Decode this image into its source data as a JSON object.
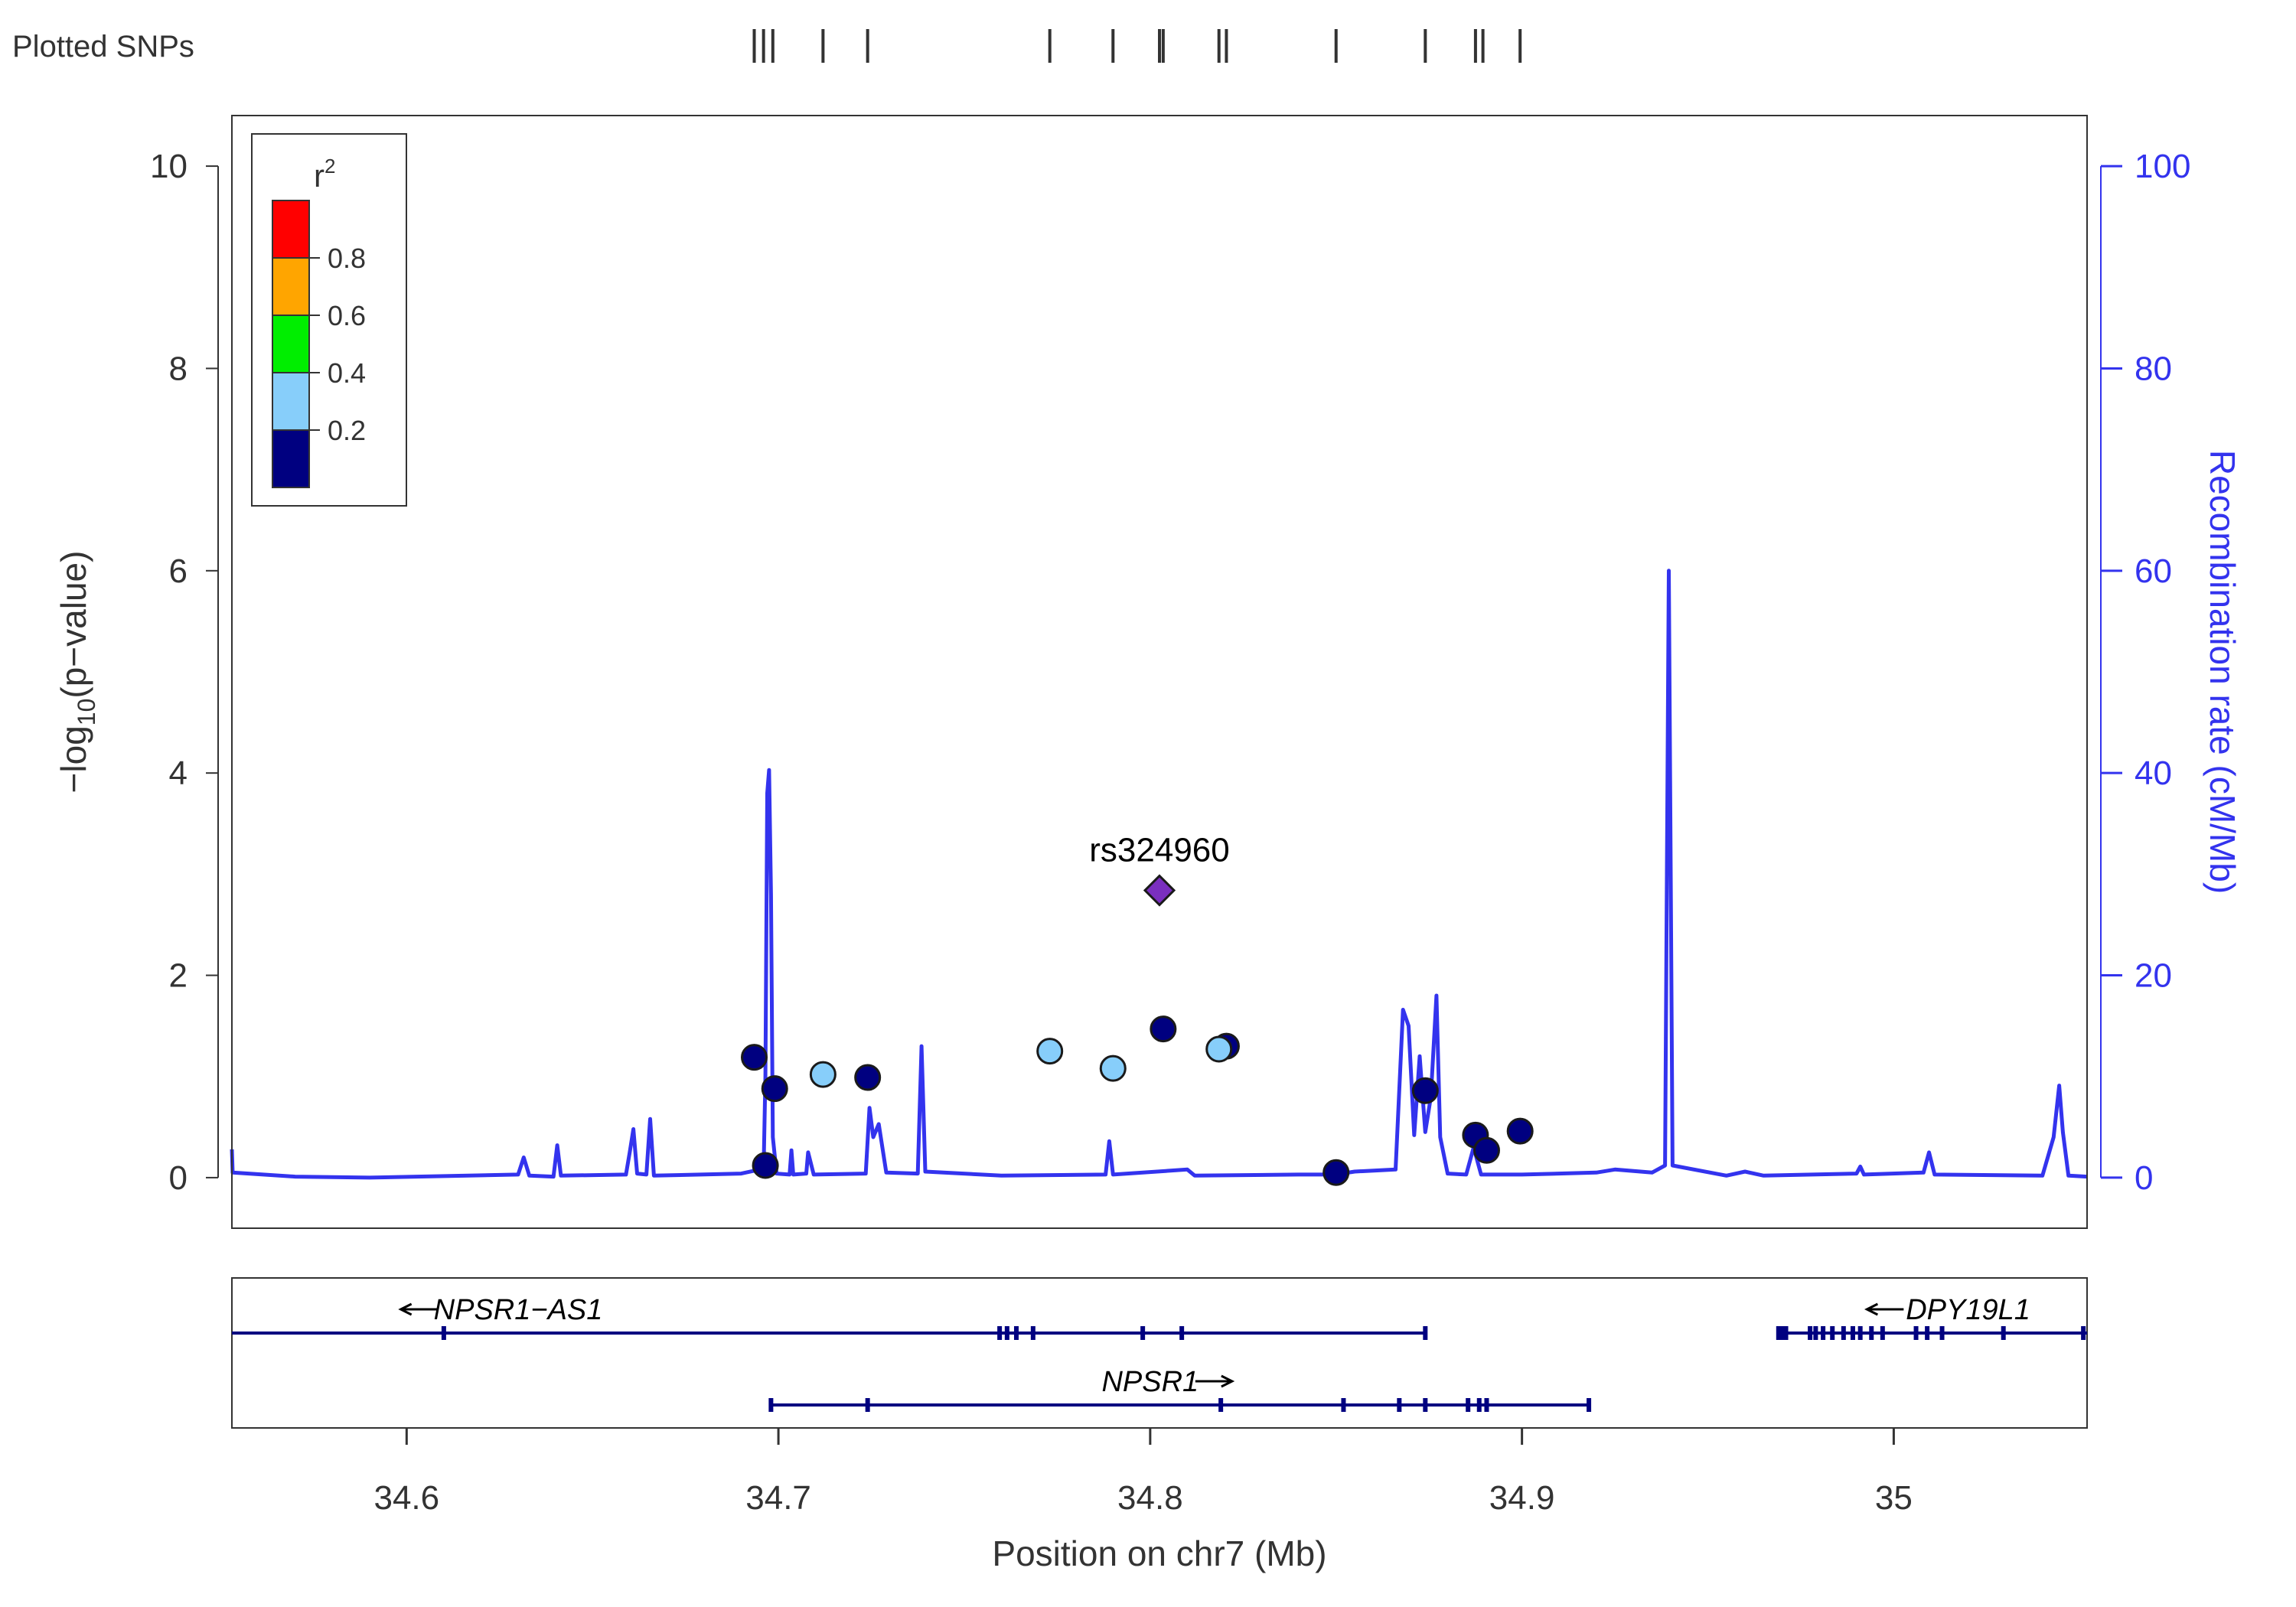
{
  "chart_data": {
    "type": "scatter",
    "xlabel": "Position on chr7 (Mb)",
    "ylabel_left": {
      "pre": "−log",
      "sub": "10",
      "post": "(p−value)"
    },
    "ylabel_right": "Recombination rate (cM/Mb)",
    "xlim": [
      34.553,
      35.052
    ],
    "ylim": [
      -0.5,
      10.5
    ],
    "y2lim": [
      -5,
      105
    ],
    "x_ticks": [
      34.6,
      34.7,
      34.8,
      34.9,
      35.0
    ],
    "x_tick_labels": [
      "34.6",
      "34.7",
      "34.8",
      "34.9",
      "35"
    ],
    "y_ticks": [
      0,
      2,
      4,
      6,
      8,
      10
    ],
    "y_tick_labels": [
      "0",
      "2",
      "4",
      "6",
      "8",
      "10"
    ],
    "y2_ticks": [
      0,
      20,
      40,
      60,
      80,
      100
    ],
    "y2_tick_labels": [
      "0",
      "20",
      "40",
      "60",
      "80",
      "100"
    ],
    "rug_label": "Plotted SNPs",
    "rug_x": [
      34.6935,
      34.696,
      34.6985,
      34.712,
      34.724,
      34.773,
      34.79,
      34.8025,
      34.8035,
      34.8185,
      34.8205,
      34.85,
      34.874,
      34.8875,
      34.8895,
      34.8995
    ],
    "points": [
      {
        "x": 34.6935,
        "y": 1.19,
        "r2_class": "lt0.2"
      },
      {
        "x": 34.6965,
        "y": 0.12,
        "r2_class": "lt0.2"
      },
      {
        "x": 34.699,
        "y": 0.88,
        "r2_class": "lt0.2"
      },
      {
        "x": 34.712,
        "y": 1.02,
        "r2_class": "0.2-0.4"
      },
      {
        "x": 34.724,
        "y": 0.99,
        "r2_class": "lt0.2"
      },
      {
        "x": 34.773,
        "y": 1.25,
        "r2_class": "0.2-0.4"
      },
      {
        "x": 34.79,
        "y": 1.08,
        "r2_class": "0.2-0.4"
      },
      {
        "x": 34.8035,
        "y": 1.47,
        "r2_class": "lt0.2"
      },
      {
        "x": 34.8205,
        "y": 1.3,
        "r2_class": "lt0.2"
      },
      {
        "x": 34.8185,
        "y": 1.27,
        "r2_class": "0.2-0.4"
      },
      {
        "x": 34.85,
        "y": 0.05,
        "r2_class": "lt0.2"
      },
      {
        "x": 34.874,
        "y": 0.86,
        "r2_class": "lt0.2"
      },
      {
        "x": 34.8875,
        "y": 0.42,
        "r2_class": "lt0.2"
      },
      {
        "x": 34.8905,
        "y": 0.27,
        "r2_class": "lt0.2"
      },
      {
        "x": 34.8995,
        "y": 0.46,
        "r2_class": "lt0.2"
      }
    ],
    "lead_snp": {
      "label": "rs324960",
      "x": 34.8025,
      "y": 2.84,
      "color": "#7a2fbf"
    },
    "recombination": [
      [
        34.553,
        2.8
      ],
      [
        34.5532,
        0.5
      ],
      [
        34.57,
        0.1
      ],
      [
        34.59,
        0.0
      ],
      [
        34.63,
        0.3
      ],
      [
        34.6315,
        2.0
      ],
      [
        34.633,
        0.2
      ],
      [
        34.6395,
        0.1
      ],
      [
        34.6405,
        3.2
      ],
      [
        34.6415,
        0.2
      ],
      [
        34.659,
        0.3
      ],
      [
        34.66,
        2.5
      ],
      [
        34.661,
        4.8
      ],
      [
        34.662,
        0.4
      ],
      [
        34.6645,
        0.3
      ],
      [
        34.6655,
        5.8
      ],
      [
        34.6665,
        0.2
      ],
      [
        34.69,
        0.4
      ],
      [
        34.695,
        0.8
      ],
      [
        34.696,
        0.6
      ],
      [
        34.6965,
        10
      ],
      [
        34.697,
        38
      ],
      [
        34.6975,
        40.3
      ],
      [
        34.698,
        28
      ],
      [
        34.6985,
        4
      ],
      [
        34.6995,
        0.4
      ],
      [
        34.703,
        0.3
      ],
      [
        34.7035,
        2.7
      ],
      [
        34.704,
        0.3
      ],
      [
        34.7075,
        0.4
      ],
      [
        34.708,
        2.5
      ],
      [
        34.7095,
        0.3
      ],
      [
        34.7235,
        0.4
      ],
      [
        34.7245,
        6.9
      ],
      [
        34.7255,
        4.0
      ],
      [
        34.727,
        5.3
      ],
      [
        34.729,
        0.5
      ],
      [
        34.7375,
        0.4
      ],
      [
        34.7385,
        13.0
      ],
      [
        34.7395,
        0.6
      ],
      [
        34.76,
        0.2
      ],
      [
        34.788,
        0.3
      ],
      [
        34.789,
        3.6
      ],
      [
        34.79,
        0.3
      ],
      [
        34.81,
        0.8
      ],
      [
        34.812,
        0.2
      ],
      [
        34.84,
        0.3
      ],
      [
        34.85,
        0.3
      ],
      [
        34.855,
        0.6
      ],
      [
        34.866,
        0.8
      ],
      [
        34.868,
        16.6
      ],
      [
        34.8695,
        15.0
      ],
      [
        34.871,
        4.2
      ],
      [
        34.8725,
        12.0
      ],
      [
        34.874,
        4.5
      ],
      [
        34.8755,
        8.0
      ],
      [
        34.877,
        18.0
      ],
      [
        34.878,
        4.0
      ],
      [
        34.88,
        0.4
      ],
      [
        34.885,
        0.3
      ],
      [
        34.887,
        3.0
      ],
      [
        34.889,
        0.3
      ],
      [
        34.9,
        0.3
      ],
      [
        34.92,
        0.5
      ],
      [
        34.925,
        0.8
      ],
      [
        34.935,
        0.5
      ],
      [
        34.9385,
        1.2
      ],
      [
        34.9395,
        60
      ],
      [
        34.9405,
        1.2
      ],
      [
        34.955,
        0.2
      ],
      [
        34.96,
        0.6
      ],
      [
        34.965,
        0.2
      ],
      [
        34.99,
        0.4
      ],
      [
        34.991,
        1.1
      ],
      [
        34.992,
        0.3
      ],
      [
        35.008,
        0.5
      ],
      [
        35.0095,
        2.5
      ],
      [
        35.011,
        0.3
      ],
      [
        35.04,
        0.2
      ],
      [
        35.043,
        4.0
      ],
      [
        35.0445,
        9.1
      ],
      [
        35.0455,
        4.5
      ],
      [
        35.047,
        0.2
      ],
      [
        35.052,
        0.1
      ]
    ],
    "genes": [
      {
        "name": "NPSR1−AS1",
        "strand": "-",
        "start": 34.553,
        "end": 34.874,
        "row": 0,
        "label_x": 34.63,
        "exons": [
          34.61,
          34.7595,
          34.7615,
          34.764,
          34.7685,
          34.798,
          34.8085,
          34.874
        ]
      },
      {
        "name": "DPY19L1",
        "strand": "-",
        "start": 34.969,
        "end": 35.052,
        "row": 0,
        "label_x": 35.02,
        "exons": [
          34.969,
          34.97,
          34.971,
          34.9775,
          34.979,
          34.981,
          34.9835,
          34.9865,
          34.989,
          34.991,
          34.994,
          34.997,
          35.006,
          35.009,
          35.013,
          35.0295,
          35.051
        ]
      },
      {
        "name": "NPSR1",
        "strand": "+",
        "start": 34.698,
        "end": 34.918,
        "row": 1,
        "label_x": 34.8,
        "exons": [
          34.698,
          34.724,
          34.819,
          34.852,
          34.867,
          34.874,
          34.8855,
          34.8885,
          34.8905,
          34.918
        ]
      }
    ],
    "legend": {
      "title": "r",
      "title_sup": "2",
      "boxes": [
        {
          "class": "0.8-1.0",
          "color": "#ff0000"
        },
        {
          "class": "0.6-0.8",
          "color": "#ffa500"
        },
        {
          "class": "0.4-0.6",
          "color": "#00ee00"
        },
        {
          "class": "0.2-0.4",
          "color": "#87cefa"
        },
        {
          "class": "lt0.2",
          "color": "#000080"
        }
      ],
      "tick_labels": [
        "0.8",
        "0.6",
        "0.4",
        "0.2"
      ]
    },
    "colors": {
      "recombination": "#3333ee",
      "gene": "#000080",
      "axis_right": "#3333ee",
      "point_outline": "#1a1a1a"
    }
  }
}
